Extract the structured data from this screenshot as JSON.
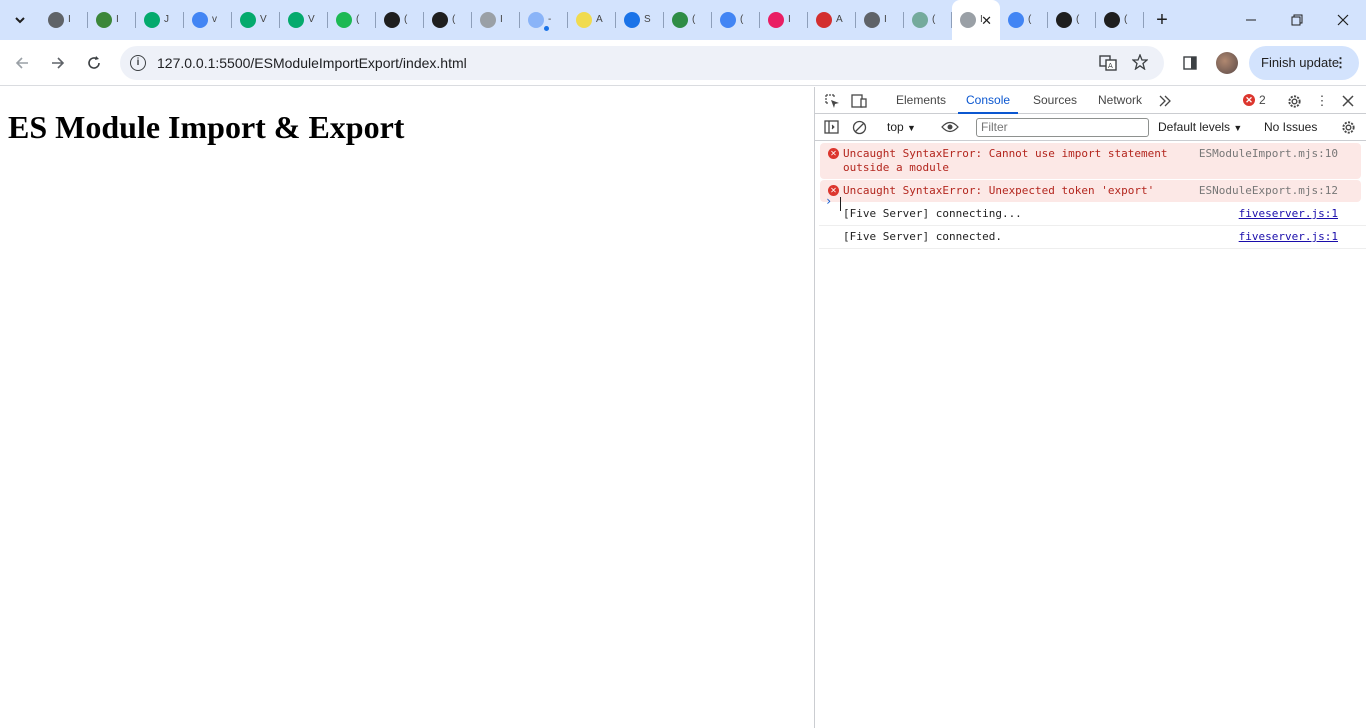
{
  "browser": {
    "tabs": [
      {
        "favicon": "globe-icon",
        "color": "#5f6368",
        "tail": "I"
      },
      {
        "favicon": "nodejs-icon",
        "color": "#3c873a",
        "tail": "I"
      },
      {
        "favicon": "w-icon",
        "color": "#04aa6d",
        "tail": "J"
      },
      {
        "favicon": "google-icon",
        "color": "#4285f4",
        "tail": "v"
      },
      {
        "favicon": "w-icon",
        "color": "#04aa6d",
        "tail": "V"
      },
      {
        "favicon": "w-icon",
        "color": "#04aa6d",
        "tail": "V"
      },
      {
        "favicon": "badge-2-icon",
        "color": "#1db954",
        "tail": "("
      },
      {
        "favicon": "github-icon",
        "color": "#1f1f1f",
        "tail": "("
      },
      {
        "favicon": "github-icon",
        "color": "#1f1f1f",
        "tail": "("
      },
      {
        "favicon": "doc-icon",
        "color": "#9aa0a6",
        "tail": "I"
      },
      {
        "favicon": "cloud-icon",
        "color": "#8ab4f8",
        "tail": "-"
      },
      {
        "favicon": "js-icon",
        "color": "#f0db4f",
        "tail": "A"
      },
      {
        "favicon": "gear-icon",
        "color": "#1a73e8",
        "tail": "S"
      },
      {
        "favicon": "gfg-icon",
        "color": "#2f8d46",
        "tail": "("
      },
      {
        "favicon": "google-icon",
        "color": "#4285f4",
        "tail": "("
      },
      {
        "favicon": "cube-icon",
        "color": "#e91e63",
        "tail": "I"
      },
      {
        "favicon": "n-icon",
        "color": "#d32f2f",
        "tail": "A"
      },
      {
        "favicon": "globe-icon",
        "color": "#5f6368",
        "tail": "I"
      },
      {
        "favicon": "chatgpt-icon",
        "color": "#74aa9c",
        "tail": "("
      },
      {
        "favicon": "page-icon",
        "color": "#9aa0a6",
        "tail": "I",
        "active": true
      },
      {
        "favicon": "google-icon",
        "color": "#4285f4",
        "tail": "("
      },
      {
        "favicon": "github-icon",
        "color": "#1f1f1f",
        "tail": "("
      },
      {
        "favicon": "github-icon",
        "color": "#1f1f1f",
        "tail": "("
      }
    ],
    "url": "127.0.0.1:5500/ESModuleImportExport/index.html",
    "update_label": "Finish update"
  },
  "page": {
    "heading": "ES Module Import & Export"
  },
  "devtools": {
    "tabs": [
      "Elements",
      "Console",
      "Sources",
      "Network"
    ],
    "active_tab": "Console",
    "error_count": "2",
    "context": "top",
    "filter_placeholder": "Filter",
    "levels": "Default levels",
    "issues": "No Issues",
    "messages": [
      {
        "type": "error",
        "text": "Uncaught SyntaxError: Cannot use import statement outside a module",
        "source": "ESModuleImport.mjs:10"
      },
      {
        "type": "error",
        "text": "Uncaught SyntaxError: Unexpected token 'export'",
        "source": "ESNoduleExport.mjs:12"
      },
      {
        "type": "log",
        "text": "[Five Server] connecting...",
        "source": "fiveserver.js:1"
      },
      {
        "type": "log",
        "text": "[Five Server] connected.",
        "source": "fiveserver.js:1"
      }
    ]
  }
}
